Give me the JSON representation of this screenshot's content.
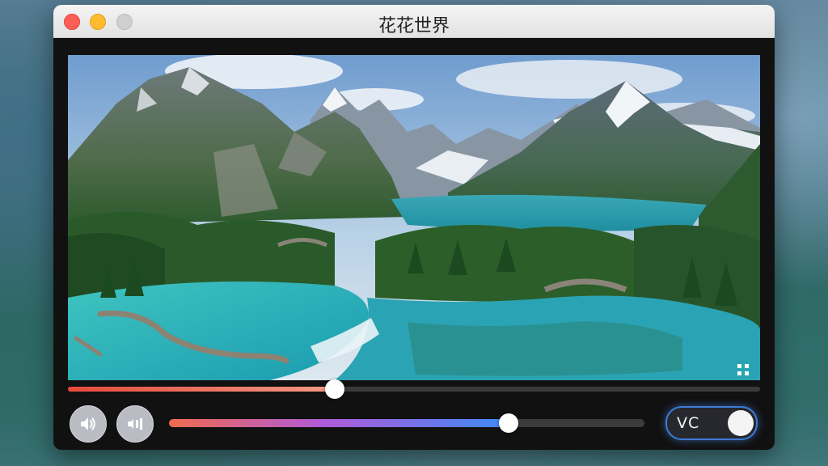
{
  "window": {
    "title": "花花世界"
  },
  "video": {
    "scene": "mountain-lake-landscape",
    "progress_fraction": 0.385
  },
  "controls": {
    "volume_fraction": 0.715,
    "vc_toggle": {
      "label": "VC",
      "state": "on"
    }
  },
  "icons": {
    "volume": "speaker-icon",
    "audio_mode": "speaker-bars-icon",
    "fullscreen": "fullscreen-icon"
  },
  "colors": {
    "seek_fill_start": "#e64a3c",
    "seek_fill_end": "#f29a86",
    "volume_gradient": [
      "#f26a4f",
      "#b05ad8",
      "#3d8bf5"
    ],
    "toggle_border": "#3f7ad6"
  }
}
